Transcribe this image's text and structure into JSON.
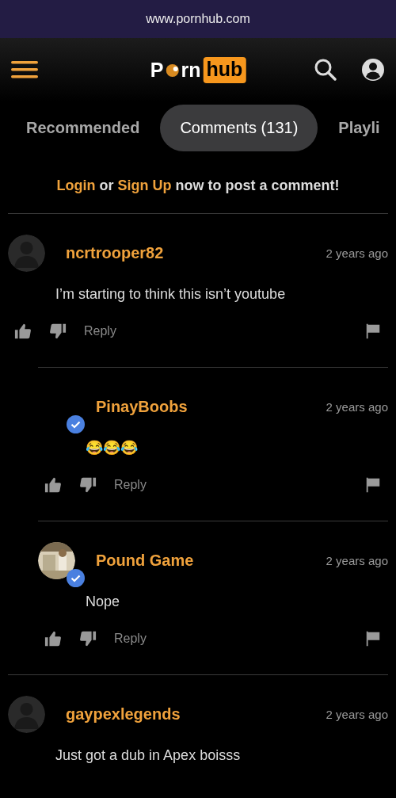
{
  "address_bar": {
    "url": "www.pornhub.com"
  },
  "header": {
    "logo": {
      "left_start": "P",
      "left_end": "rn",
      "right": "hub"
    }
  },
  "tabs": [
    {
      "label": "Recommended",
      "selected": false
    },
    {
      "label": "Comments (131)",
      "selected": true
    },
    {
      "label": "Playli",
      "selected": false
    }
  ],
  "login_prompt": {
    "login_link": "Login",
    "joiner": "or",
    "signup_link": "Sign Up",
    "rest": "now to post a comment!"
  },
  "comments": [
    {
      "username": "ncrtrooper82",
      "time": "2 years ago",
      "text": "I’m starting to think this isn’t youtube",
      "avatar": {
        "kind": "placeholder"
      },
      "verified": false,
      "reply_label": "Reply",
      "children": [
        {
          "username": "PinayBoobs",
          "time": "2 years ago",
          "text": "😂😂😂",
          "verified": true,
          "reply_label": "Reply"
        },
        {
          "username": "Pound Game",
          "time": "2 years ago",
          "text": "Nope",
          "verified": true,
          "reply_label": "Reply"
        }
      ]
    },
    {
      "username": "gaypexlegends",
      "time": "2 years ago",
      "text": "Just got a dub in Apex boisss",
      "avatar": {
        "kind": "placeholder"
      },
      "verified": false
    }
  ]
}
